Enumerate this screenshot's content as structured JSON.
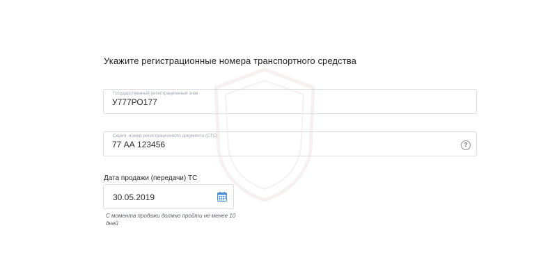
{
  "form": {
    "title": "Укажите регистрационные номера транспортного средства",
    "plate": {
      "label": "Государственный регистрационный знак",
      "value": "У777РО177"
    },
    "sts": {
      "label": "Серия, номер регистрационного документа (СТС)",
      "value": "77 АА 123456",
      "help_symbol": "?"
    },
    "sale_date": {
      "label": "Дата продажи (передачи) ТС",
      "value": "30.05.2019",
      "hint": "С момента продажи должно пройти не менее 10 дней"
    }
  },
  "icons": {
    "help": "question-icon",
    "calendar": "calendar-icon",
    "watermark": "shield-watermark"
  },
  "colors": {
    "accent": "#4a90d9",
    "border": "#d9dde2",
    "label": "#9aa3ad"
  }
}
